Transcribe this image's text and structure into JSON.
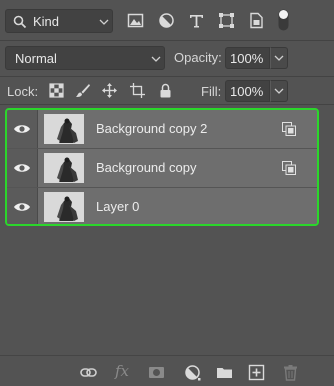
{
  "filter": {
    "kind_label": "Kind",
    "icons": [
      "image-filter-icon",
      "adjustment-filter-icon",
      "type-filter-icon",
      "shape-filter-icon",
      "smart-object-filter-icon"
    ]
  },
  "blend": {
    "mode": "Normal",
    "opacity_label": "Opacity:",
    "opacity_value": "100%"
  },
  "lock": {
    "label": "Lock:",
    "fill_label": "Fill:",
    "fill_value": "100%"
  },
  "layers": [
    {
      "name": "Background copy 2",
      "visible": true,
      "smart_object": true
    },
    {
      "name": "Background copy",
      "visible": true,
      "smart_object": true
    },
    {
      "name": "Layer 0",
      "visible": true,
      "smart_object": false
    }
  ],
  "bottom_toolbar": {
    "fx_label": "fx",
    "icons": [
      "link-layers-icon",
      "layer-style-icon",
      "add-mask-icon",
      "adjustment-layer-icon",
      "new-group-icon",
      "new-layer-icon",
      "delete-layer-icon"
    ]
  },
  "colors": {
    "panel_bg": "#535353",
    "field_bg": "#424242",
    "layer_row_bg": "#6e6e6e",
    "selection_outline": "#2bd62b"
  }
}
